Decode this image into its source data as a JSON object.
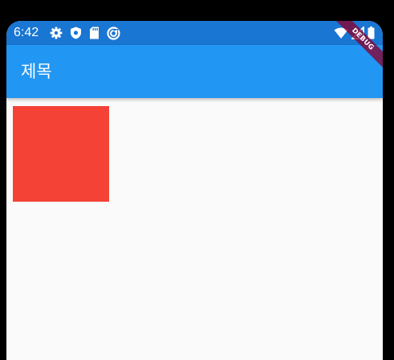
{
  "status_bar": {
    "time": "6:42",
    "left_icons": [
      "settings-icon",
      "shield-icon",
      "sd-card-icon",
      "sync-circle-icon"
    ],
    "right_icons": [
      "wifi-icon",
      "signal-icon",
      "battery-icon"
    ],
    "color": "#1976d2"
  },
  "app_bar": {
    "title": "제목",
    "color": "#2196f3"
  },
  "body": {
    "background": "#fafafa",
    "box_color": "#f44336"
  },
  "debug_banner": {
    "label": "DEBUG"
  }
}
